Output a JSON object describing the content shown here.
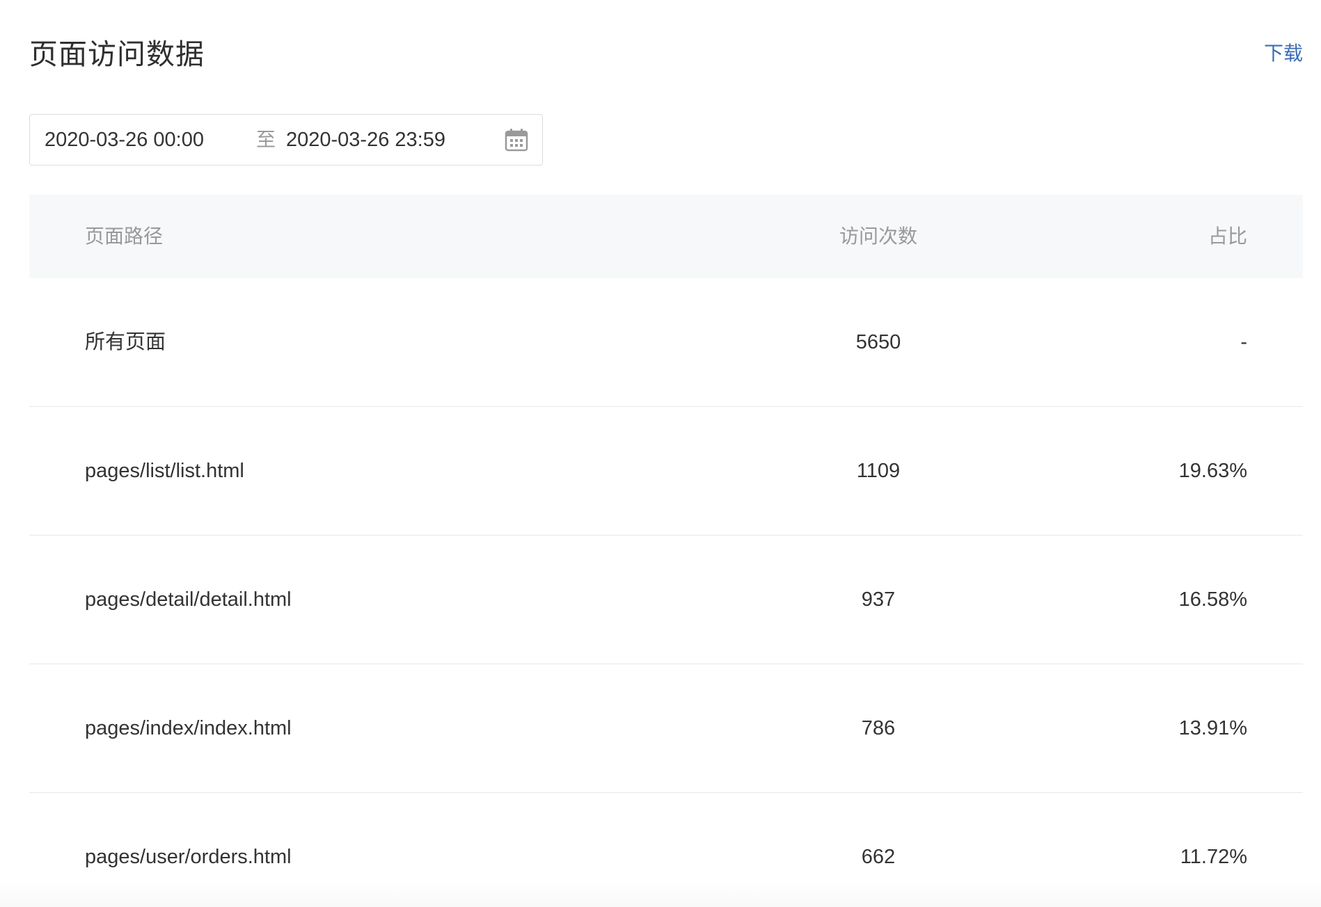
{
  "header": {
    "title": "页面访问数据",
    "download_label": "下载"
  },
  "date_range": {
    "start": "2020-03-26 00:00",
    "separator": "至",
    "end": "2020-03-26 23:59",
    "icon": "calendar-icon"
  },
  "table": {
    "columns": [
      "页面路径",
      "访问次数",
      "占比"
    ],
    "rows": [
      {
        "path": "所有页面",
        "visits": "5650",
        "ratio": "-"
      },
      {
        "path": "pages/list/list.html",
        "visits": "1109",
        "ratio": "19.63%"
      },
      {
        "path": "pages/detail/detail.html",
        "visits": "937",
        "ratio": "16.58%"
      },
      {
        "path": "pages/index/index.html",
        "visits": "786",
        "ratio": "13.91%"
      },
      {
        "path": "pages/user/orders.html",
        "visits": "662",
        "ratio": "11.72%"
      }
    ]
  },
  "colors": {
    "link": "#3a6cb5",
    "header_bg": "#f7f8f9",
    "border": "#e8e8e8"
  }
}
